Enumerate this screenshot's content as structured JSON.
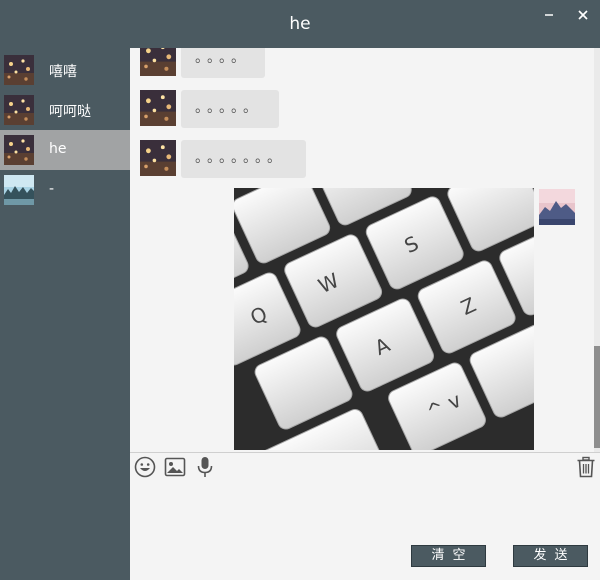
{
  "window": {
    "title": "he",
    "minimize_glyph": "–",
    "close_glyph": "✕"
  },
  "contacts": [
    {
      "name": "嘻嘻",
      "avatar": "night-lights-avatar",
      "active": false
    },
    {
      "name": "呵呵哒",
      "avatar": "night-lights-avatar",
      "active": false
    },
    {
      "name": "he",
      "avatar": "night-lights-avatar",
      "active": true
    },
    {
      "name": "-",
      "avatar": "mountain-lake-avatar",
      "active": false
    }
  ],
  "messages": [
    {
      "from": "contact",
      "text": "。。。。"
    },
    {
      "from": "contact",
      "text": "。。。。。"
    },
    {
      "from": "contact",
      "text": "。。。。。。。"
    },
    {
      "from": "me",
      "type": "image",
      "image": "keyboard-photo"
    }
  ],
  "toolbar": {
    "icons": [
      "emoji-icon",
      "image-icon",
      "microphone-icon"
    ],
    "trash_icon": "trash-icon"
  },
  "composer": {
    "value": ""
  },
  "buttons": {
    "clear_label": "清空",
    "send_label": "发送"
  },
  "colors": {
    "frame": "#4b5a61",
    "active_contact": "#a1a3a4",
    "chat_bg": "#f4f4f4",
    "bubble": "#e3e3e3"
  }
}
